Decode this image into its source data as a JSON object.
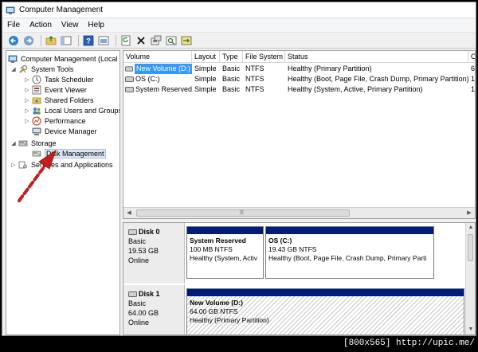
{
  "window": {
    "title": "Computer Management"
  },
  "menu": [
    "File",
    "Action",
    "View",
    "Help"
  ],
  "toolbar": [
    "back-icon",
    "forward-icon",
    "up-folder-icon",
    "show-hide-tree-icon",
    "help-icon",
    "console-view-icon",
    "refresh-icon",
    "delete-icon",
    "properties-icon",
    "rescan-disks-icon",
    "export-icon"
  ],
  "tree": {
    "root": "Computer Management (Local",
    "system_tools": "System Tools",
    "task_scheduler": "Task Scheduler",
    "event_viewer": "Event Viewer",
    "shared_folders": "Shared Folders",
    "local_users": "Local Users and Groups",
    "performance": "Performance",
    "device_manager": "Device Manager",
    "storage": "Storage",
    "disk_management": "Disk Management",
    "services": "Services and Applications"
  },
  "volumes": {
    "headers": [
      "Volume",
      "Layout",
      "Type",
      "File System",
      "Status",
      "C"
    ],
    "rows": [
      {
        "volume": "New Volume (D:)",
        "layout": "Simple",
        "type": "Basic",
        "fs": "NTFS",
        "status": "Healthy (Primary Partition)",
        "cap": "6"
      },
      {
        "volume": "OS (C:)",
        "layout": "Simple",
        "type": "Basic",
        "fs": "NTFS",
        "status": "Healthy (Boot, Page File, Crash Dump, Primary Partition)",
        "cap": "1"
      },
      {
        "volume": "System Reserved",
        "layout": "Simple",
        "type": "Basic",
        "fs": "NTFS",
        "status": "Healthy (System, Active, Primary Partition)",
        "cap": "1("
      }
    ]
  },
  "disks": [
    {
      "name": "Disk 0",
      "type": "Basic",
      "size": "19.53 GB",
      "state": "Online",
      "partitions": [
        {
          "name": "System Reserved",
          "size": "100 MB NTFS",
          "status": "Healthy (System, Activ"
        },
        {
          "name": "OS  (C:)",
          "size": "19.43 GB NTFS",
          "status": "Healthy (Boot, Page File, Crash Dump, Primary Parti"
        }
      ]
    },
    {
      "name": "Disk 1",
      "type": "Basic",
      "size": "64.00 GB",
      "state": "Online",
      "partitions": [
        {
          "name": "New Volume  (D:)",
          "size": "64.00 GB NTFS",
          "status": "Healthy (Primary Partition)"
        }
      ]
    }
  ],
  "watermark": "[800x565] http://upic.me/",
  "colors": {
    "partition_bar": "#001d7a",
    "selection": "#3399ff",
    "arrow": "#c0201f"
  }
}
